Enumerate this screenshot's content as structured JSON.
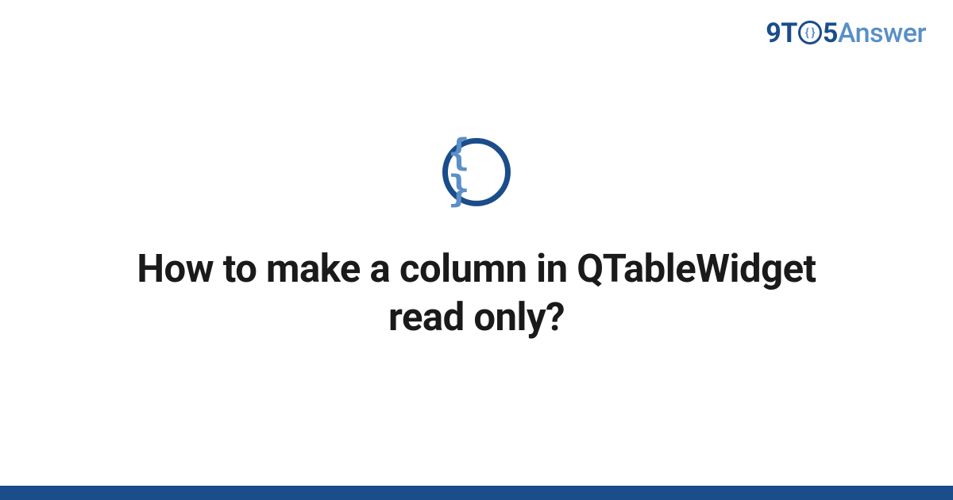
{
  "brand": {
    "part1": "9T",
    "circle_text": "{ }",
    "part2": "5",
    "part3": "Answer"
  },
  "icon": {
    "braces": "{ }"
  },
  "heading": "How to make a column in QTableWidget read only?",
  "colors": {
    "primary": "#1a4d8a",
    "secondary": "#5a8fc7"
  }
}
